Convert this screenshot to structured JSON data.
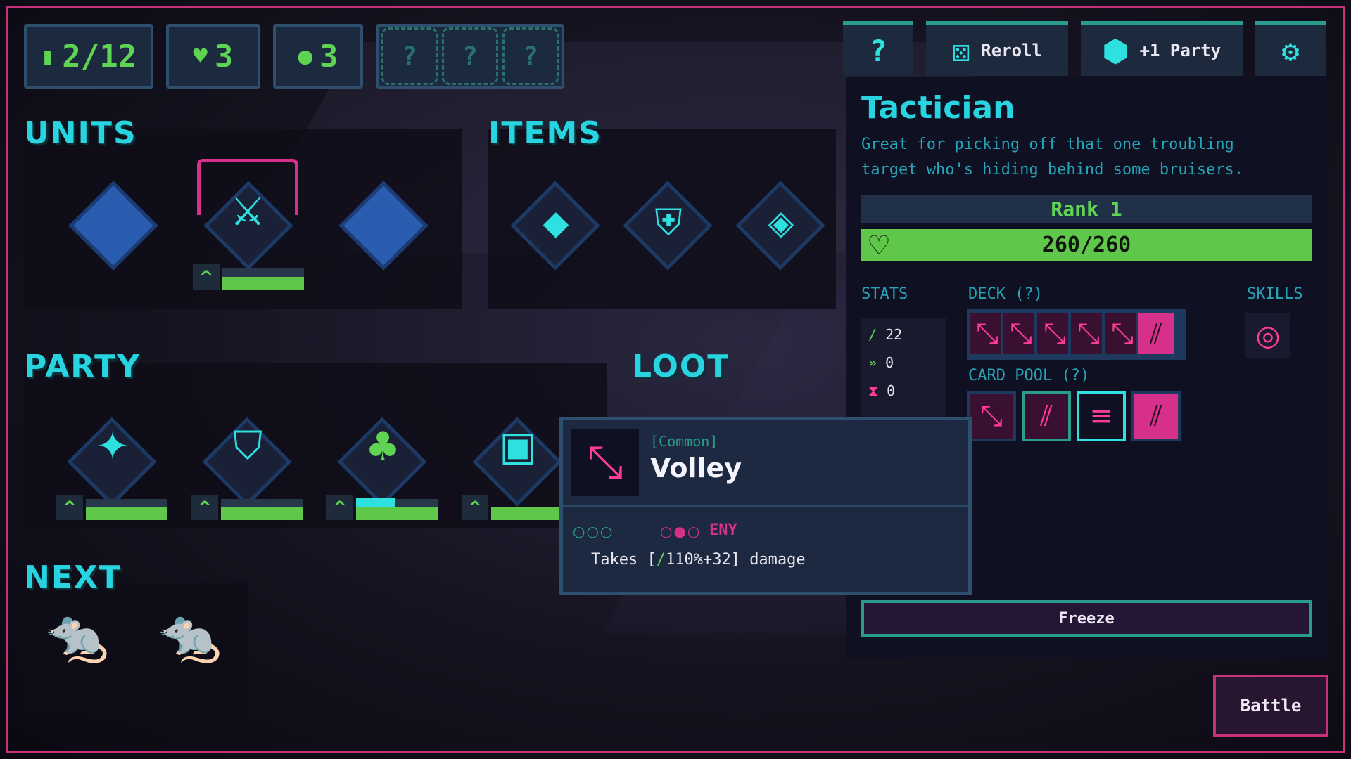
{
  "hud": {
    "round": "2/12",
    "lives": "3",
    "gold": "3",
    "mystery_slots": [
      "?",
      "?",
      "?"
    ]
  },
  "toolbar": {
    "help_label": "?",
    "reroll_label": "Reroll",
    "party_label": "+1 Party",
    "settings_icon": "gear-icon"
  },
  "sections": {
    "units": "UNITS",
    "items": "ITEMS",
    "party": "PARTY",
    "loot": "LOOT",
    "next": "NEXT"
  },
  "detail": {
    "name": "Tactician",
    "description_line1": "Great for picking off that one troubling",
    "description_line2": "target who's hiding behind some bruisers.",
    "rank": "Rank 1",
    "hp": "260/260",
    "stats_label": "STATS",
    "deck_label": "DECK (?)",
    "skills_label": "SKILLS",
    "card_pool_label": "CARD POOL (?)",
    "stats": [
      {
        "icon": "sword-icon",
        "value": "22"
      },
      {
        "icon": "runner-icon",
        "value": "0"
      },
      {
        "icon": "hourglass-icon",
        "value": "0"
      }
    ],
    "freeze_label": "Freeze"
  },
  "tooltip": {
    "rarity": "[Common]",
    "name": "Volley",
    "target": "ENY",
    "effect_prefix": "Takes [",
    "effect_value": "110%+32]",
    "effect_suffix": "damage"
  },
  "battle_label": "Battle",
  "colors": {
    "accent_cyan": "#27d4e0",
    "accent_green": "#5fd453",
    "accent_pink": "#ff3c9a",
    "frame": "#c8307a"
  }
}
